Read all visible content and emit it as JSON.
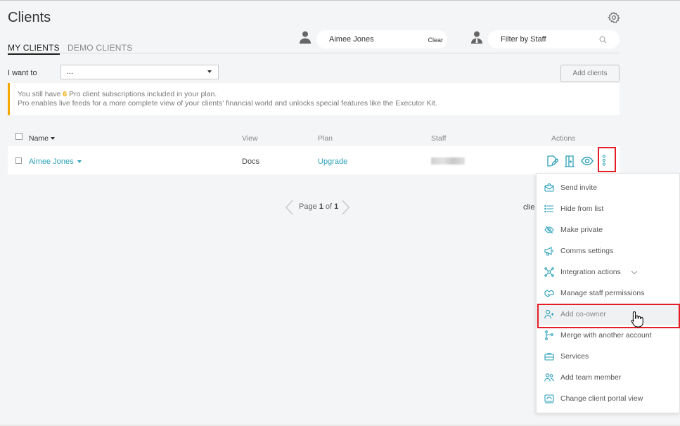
{
  "page": {
    "title": "Clients"
  },
  "tabs": [
    {
      "label": "MY CLIENTS",
      "active": true
    },
    {
      "label": "DEMO CLIENTS",
      "active": false
    }
  ],
  "client_filter": {
    "value": "Aimee Jones",
    "clear_label": "Clear"
  },
  "staff_filter": {
    "placeholder": "Filter by Staff"
  },
  "toolbar": {
    "i_want_to_label": "I want to",
    "select_value": "...",
    "add_clients_label": "Add clients"
  },
  "notice": {
    "line1_prefix": "You still have ",
    "line1_count": "6",
    "line1_suffix": " Pro client subscriptions included in your plan.",
    "line2": "Pro enables live feeds for a more complete view of your clients' financial world and unlocks special features like the Executor Kit."
  },
  "table": {
    "headers": {
      "name": "Name",
      "view": "View",
      "plan": "Plan",
      "staff": "Staff",
      "actions": "Actions"
    },
    "rows": [
      {
        "name": "Aimee Jones",
        "view": "Docs",
        "plan": "Upgrade"
      }
    ]
  },
  "pagination": {
    "prefix": "Page ",
    "current": "1",
    "of": " of ",
    "total": "1",
    "clients_partial": "clie"
  },
  "actions_menu": {
    "items": [
      {
        "label": "Send invite",
        "icon": "envelope-icon"
      },
      {
        "label": "Hide from list",
        "icon": "list-icon"
      },
      {
        "label": "Make private",
        "icon": "eye-slash-icon"
      },
      {
        "label": "Comms settings",
        "icon": "megaphone-icon"
      },
      {
        "label": "Integration actions",
        "icon": "network-icon",
        "has_submenu": true
      },
      {
        "label": "Manage staff permissions",
        "icon": "handshake-icon"
      },
      {
        "label": "Add co-owner",
        "icon": "user-plus-icon",
        "hovered": true
      },
      {
        "label": "Merge with another account",
        "icon": "merge-icon"
      },
      {
        "label": "Services",
        "icon": "briefcase-icon"
      },
      {
        "label": "Add team member",
        "icon": "users-icon"
      },
      {
        "label": "Change client portal view",
        "icon": "portal-icon"
      }
    ]
  },
  "colors": {
    "accent": "#2a9fb8",
    "highlight": "#e41e26",
    "notice": "#f7a800"
  }
}
